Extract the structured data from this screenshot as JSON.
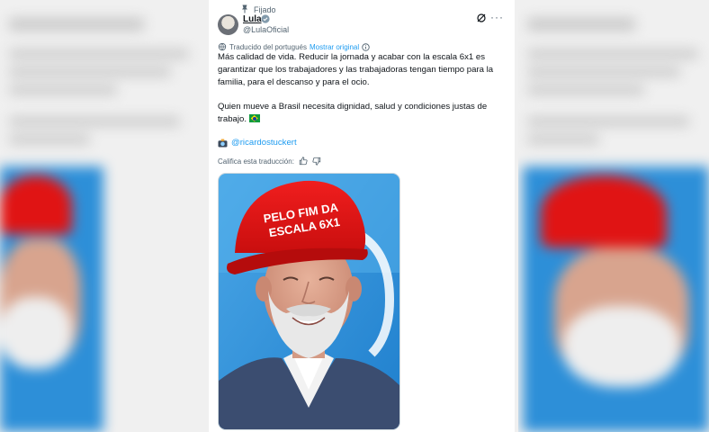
{
  "tweet": {
    "pinned_label": "Fijado",
    "author_name": "Lula",
    "author_handle": "@LulaOficial",
    "translated_label": "Traducido del portugués",
    "show_original_label": "Mostrar original",
    "paragraph_1": "Más calidad de vida. Reducir la jornada y acabar con la escala 6x1 es garantizar que los trabajadores y las trabajadoras tengan tiempo para la familia, para el descanso y para el ocio.",
    "paragraph_2": "Quien mueve a Brasil necesita dignidad, salud y condiciones justas de trabajo.",
    "mention": "@ricardostuckert",
    "rate_label": "Califica esta traducción:",
    "more_label": "···"
  },
  "image": {
    "cap_text_line_1": "PELO FIM DA",
    "cap_text_line_2": "ESCALA 6X1"
  },
  "colors": {
    "accent": "#1d9bf0",
    "text": "#0f1419",
    "muted": "#536471",
    "cap_red": "#e01414",
    "photo_bg": "#2b8fd9"
  },
  "icons": [
    "pin-icon",
    "verified-badge-icon",
    "grok-icon",
    "more-icon",
    "translate-icon",
    "brazil-flag-icon",
    "camera-icon",
    "thumbs-up-icon",
    "thumbs-down-icon"
  ]
}
